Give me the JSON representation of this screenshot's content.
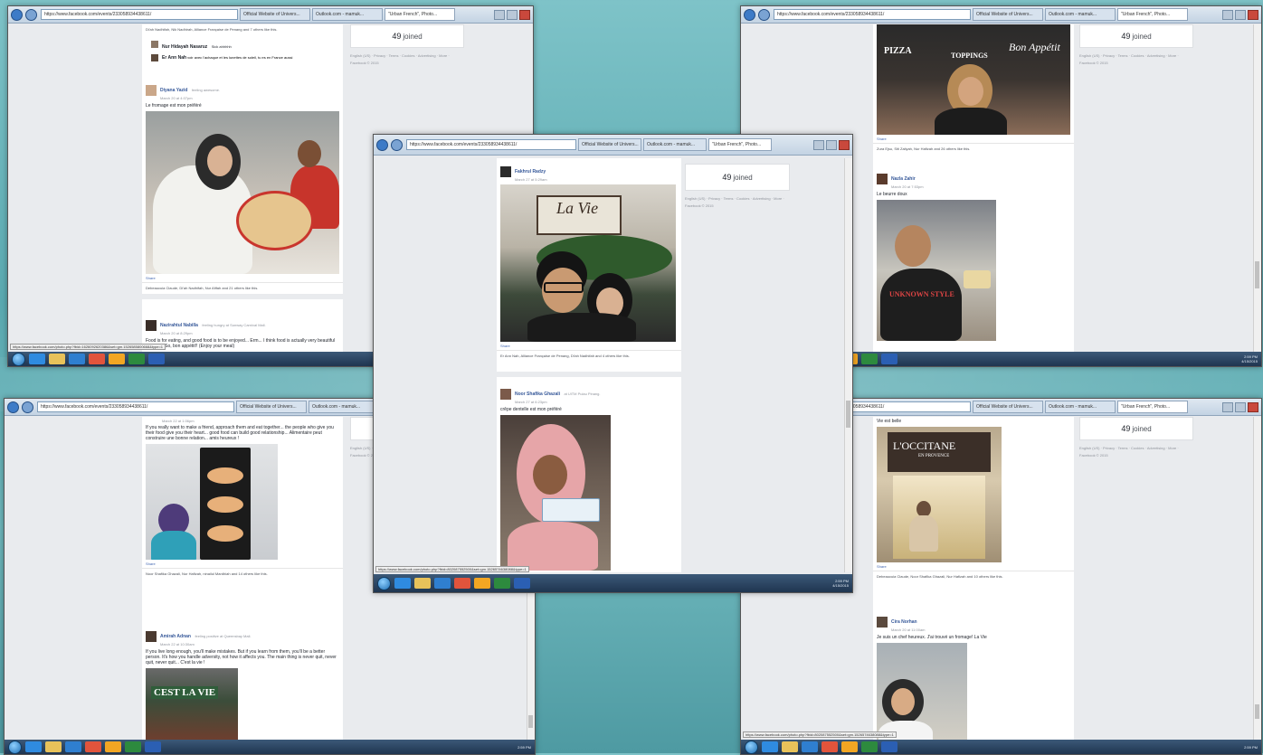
{
  "browser": {
    "url": "https://www.facebook.com/events/233058934438611/",
    "tabs": [
      "Official Website of Univers...",
      "Outlook.com - mamuk...",
      "\"Urban French\", Photo..."
    ]
  },
  "event_sidebar": {
    "joined_count": "49",
    "joined_label": "joined",
    "footer_links": "English (US) · Privacy · Terms · Cookies · Advertising · More ·",
    "copyright": "Facebook © 2015"
  },
  "taskbar": {
    "time": "2:59 PM",
    "date": "4/15/2015"
  },
  "panel_tl": {
    "comments": [
      {
        "name": "Nur Hidayah Nasaruz",
        "text": "Sick ahhhhh"
      },
      {
        "name": "Er Ann Nah",
        "text": "voir avec l'achaque et les lunettes de soleil, tu es en France aussi"
      }
    ],
    "post1": {
      "author": "Diyana Yazid",
      "feeling": "feeling awesome.",
      "time": "March 20 at 4:07pm",
      "text": "Le fromage est mon préféré",
      "share": "Share",
      "likes": "Debeaucuia Claude, Di'ah Nadhifah, Nur Afifah and 21 others like this."
    },
    "post2": {
      "author": "Nazirahtul Nabilla",
      "feeling": "feeling hungry at Sunway Carnival Mall.",
      "time": "March 20 at 8:29pm",
      "text": "Food is for eating, and good food is to be enjoyed... Erm... I think food is actually very beautiful in itself... So, bon appétit!! (Enjoy your meal)"
    },
    "likes_top": "Di'ah Nadhifah, Nik Nadhirah, Alliance Française de Penang and 7 others like this.",
    "status_url": "https://www.facebook.com/photo.php?fbid=1626092620386&set=gm.1526585800668&type=1"
  },
  "panel_tr": {
    "sign1": "PIZZA",
    "sign2": "TOPPINGS",
    "sign3": "Bon Appétit",
    "share": "Share",
    "likes": "Zura Ejsu, Siti Zaliyah, Nur Hafizah and 26 others like this.",
    "post": {
      "author": "Nazla Zahir",
      "time": "March 20 at 7:53pm",
      "text": "Le beurre doux",
      "shirt": "UNKNOWN STYLE"
    }
  },
  "panel_center": {
    "post1": {
      "author": "Fakhrul Radzy",
      "time": "March 27 at 5:29am",
      "sign": "La Vie",
      "share": "Share",
      "likes": "Er Ann Nah, Alliance Française de Penang, Di'ah Nadhifah and 4 others like this."
    },
    "post2": {
      "author": "Noor Shafika Ghazali",
      "location": "at UiTM Pulau Pinang.",
      "time": "March 27 at 6:23pm",
      "text": "crêpe dentelle est mon préféré"
    },
    "status_url": "https://www.facebook.com/photo.php?fbid=802087552500&set=gm.1526574638088&type=1"
  },
  "panel_bl": {
    "post1_time": "March 22 at 1:06pm",
    "post1_text": "If you really want to make a friend, approach them and eat together... the people who give you their food give you their heart... good food can build good relationship... Alimentaire peut construire une bonne relation... amis heureux !",
    "share": "Share",
    "likes": "Noor Shafika Ghazali, Nur Hafizah, ninailul Mardhiah and 14 others like this.",
    "post2": {
      "author": "Amirah Adnan",
      "feeling": "feeling positive at Queensbay Mall.",
      "time": "March 22 at 10:30am",
      "text": "If you live long enough, you'll make mistakes. But if you learn from them, you'll be a better person. It's how you handle adversity, not how it affects you. The main thing is never quit, never quit, never quit... C'est la vie !",
      "sign": "CEST LA VIE"
    }
  },
  "panel_br": {
    "top_text": "Vie est belle",
    "sign1": "L'OCCITANE",
    "sign2": "EN PROVENCE",
    "share": "Share",
    "likes": "Debeaucuia Claude, Noor Shafika Ghazali, Nur Hafizah and 10 others like this.",
    "post": {
      "author": "Cira Norhan",
      "time": "March 20 at 11:00am",
      "text": "Je suis un chef heureux. J'ai trouvé un fromage! La Vie"
    }
  },
  "colors": {
    "facebook_blue": "#365899",
    "facebook_bg": "#e9ebee",
    "taskbar": "#1f3550"
  }
}
